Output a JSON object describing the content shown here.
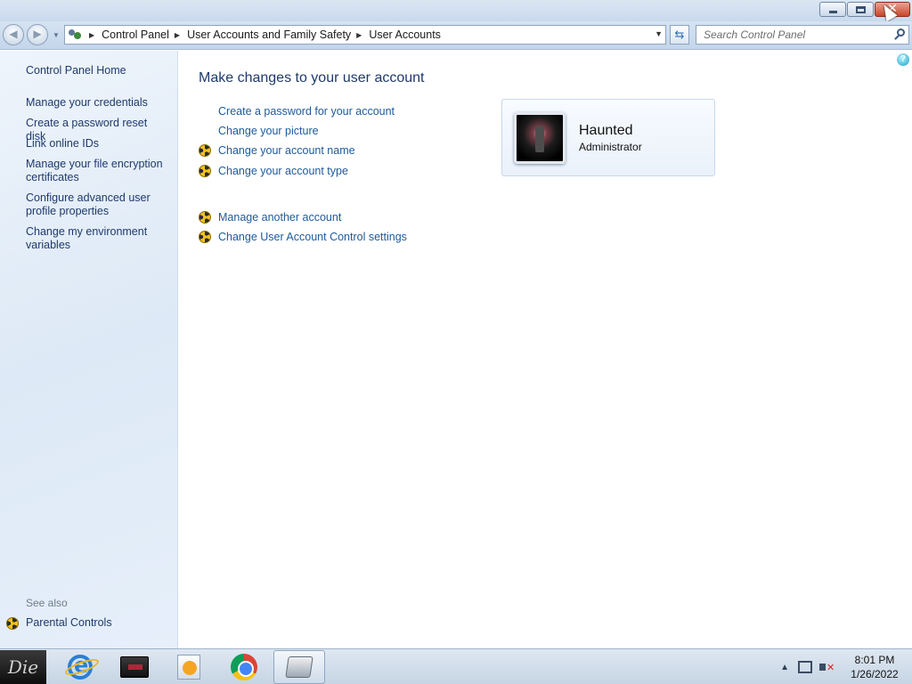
{
  "window": {
    "minimize_icon": "minimize-icon",
    "maximize_icon": "restore-icon",
    "close_icon": "close-icon"
  },
  "navigation": {
    "breadcrumbs": [
      "Control Panel",
      "User Accounts and Family Safety",
      "User Accounts"
    ],
    "search_placeholder": "Search Control Panel"
  },
  "sidebar": {
    "home_label": "Control Panel Home",
    "items": [
      {
        "label": "Manage your credentials"
      },
      {
        "label": "Create a password reset disk"
      },
      {
        "label": "Link online IDs"
      },
      {
        "label": "Manage your file encryption certificates"
      },
      {
        "label": "Configure advanced user profile properties"
      },
      {
        "label": "Change my environment variables"
      }
    ],
    "see_also_label": "See also",
    "see_also_items": [
      {
        "label": "Parental Controls",
        "shield": true
      }
    ]
  },
  "main": {
    "heading": "Make changes to your user account",
    "tasks": [
      {
        "label": "Create a password for your account",
        "shield": false
      },
      {
        "label": "Change your picture",
        "shield": false
      },
      {
        "label": "Change your account name",
        "shield": true
      },
      {
        "label": "Change your account type",
        "shield": true
      }
    ],
    "other_tasks": [
      {
        "label": "Manage another account",
        "shield": true
      },
      {
        "label": "Change User Account Control settings",
        "shield": true
      }
    ],
    "user": {
      "name": "Haunted",
      "type": "Administrator"
    }
  },
  "taskbar": {
    "start_label": "Die",
    "pinned": [
      "internet-explorer",
      "windows-explorer",
      "media-player",
      "google-chrome",
      "control-panel"
    ],
    "clock_time": "8:01 PM",
    "clock_date": "1/26/2022"
  },
  "colors": {
    "link": "#1e5a9c",
    "heading": "#1e3a6b",
    "sidebar_bg": "#e3edf8"
  }
}
